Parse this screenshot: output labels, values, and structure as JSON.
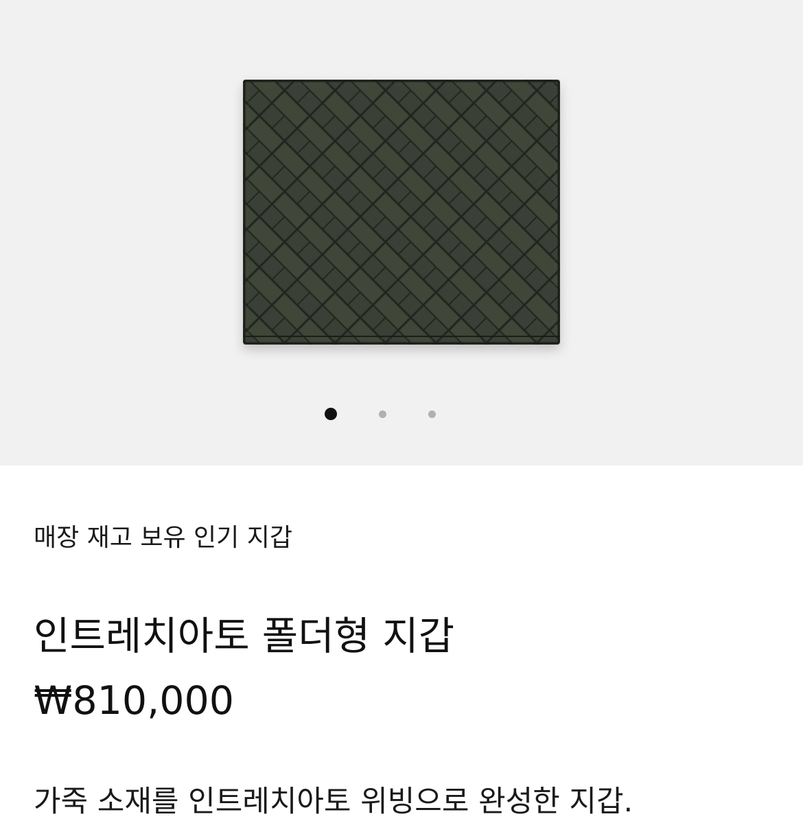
{
  "gallery": {
    "image_alt": "인트레치아토 폴더형 지갑",
    "slide_count": 3,
    "active_slide": 1
  },
  "product": {
    "tagline": "매장 재고 보유 인기 지갑",
    "title": "인트레치아토 폴더형 지갑",
    "price": "₩810,000",
    "description": "가죽 소재를 인트레치아토 위빙으로 완성한 지갑."
  },
  "colors": {
    "gallery_bg": "#f1f1f1",
    "wallet_leather": "#2f342b",
    "dot_active": "#111111",
    "dot_inactive": "#b0b0b0"
  }
}
